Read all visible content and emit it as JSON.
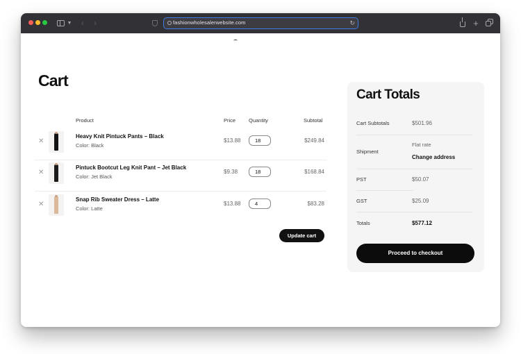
{
  "browser": {
    "url": "fashionwholesalerwebsite.com"
  },
  "page": {
    "title": "Cart"
  },
  "table": {
    "headers": {
      "product": "Product",
      "price": "Price",
      "quantity": "Quantity",
      "subtotal": "Subtotal"
    },
    "rows": [
      {
        "name": "Heavy Knit Pintuck Pants – Black",
        "color": "Color: Black",
        "price": "$13.88",
        "quantity": "18",
        "subtotal": "$249.84",
        "swatch": "#141414"
      },
      {
        "name": "Pintuck Bootcut Leg Knit Pant – Jet Black",
        "color": "Color: Jet Black",
        "price": "$9.38",
        "quantity": "18",
        "subtotal": "$168.84",
        "swatch": "#1c1c1c"
      },
      {
        "name": "Snap Rib Sweater Dress – Latte",
        "color": "Color: Latte",
        "price": "$13.88",
        "quantity": "4",
        "subtotal": "$83.28",
        "swatch": "#d9b99a"
      }
    ]
  },
  "actions": {
    "update_cart": "Update cart"
  },
  "totals": {
    "title": "Cart Totals",
    "cart_subtotal_label": "Cart Subtotals",
    "cart_subtotal_value": "$501.96",
    "shipment_label": "Shipment",
    "shipment_method": "Flat rate",
    "change_address": "Change address",
    "pst_label": "PST",
    "pst_value": "$50.07",
    "gst_label": "GST",
    "gst_value": "$25.09",
    "totals_label": "Totals",
    "totals_value": "$577.12",
    "checkout_label": "Proceed to checkout"
  }
}
